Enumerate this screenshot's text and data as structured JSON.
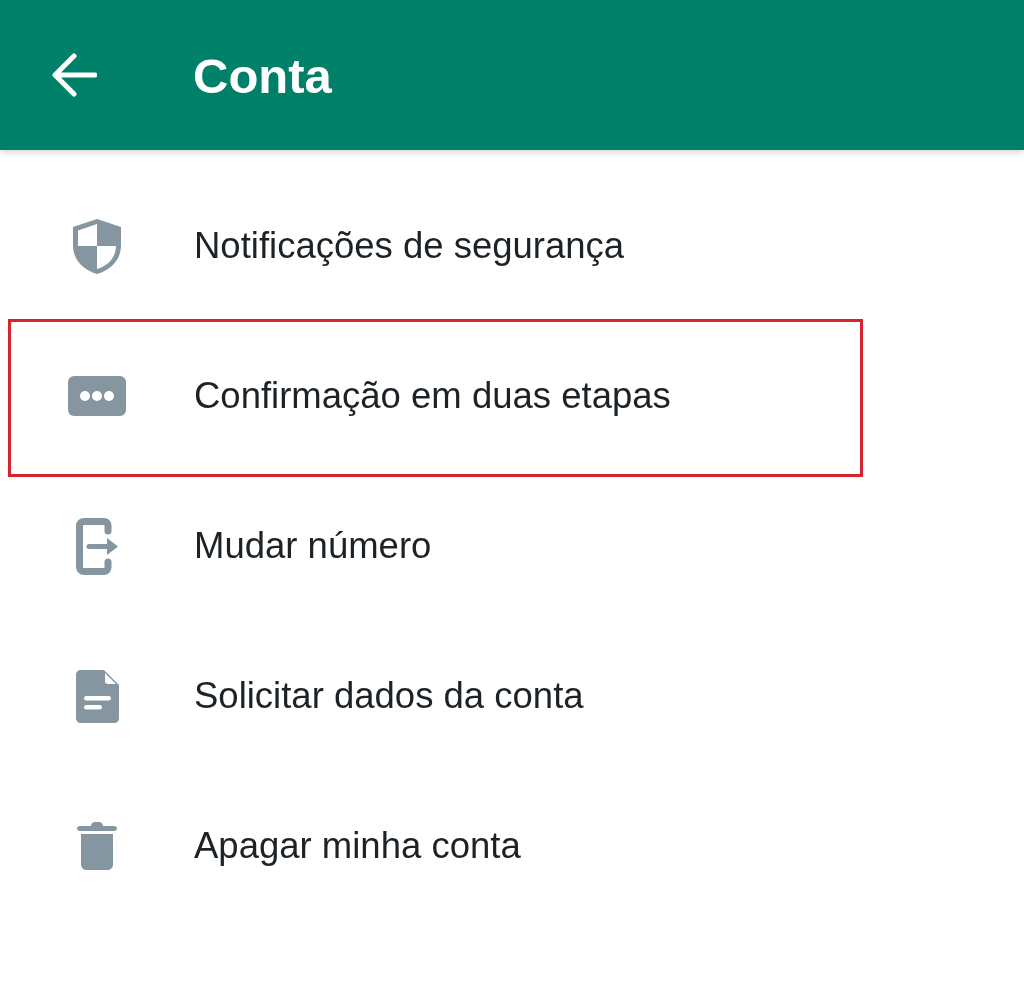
{
  "app_bar": {
    "title": "Conta"
  },
  "items": [
    {
      "kind": "shield",
      "label": "Notificações de segurança",
      "highlighted": false
    },
    {
      "kind": "dots",
      "label": "Confirmação em duas etapas",
      "highlighted": true
    },
    {
      "kind": "exit",
      "label": "Mudar número",
      "highlighted": false
    },
    {
      "kind": "document",
      "label": "Solicitar dados da conta",
      "highlighted": false
    },
    {
      "kind": "trash",
      "label": "Apagar minha conta",
      "highlighted": false
    }
  ]
}
